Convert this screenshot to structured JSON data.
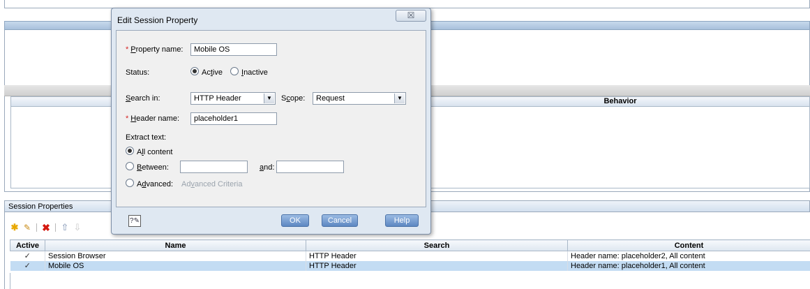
{
  "behavior_panel": {
    "column_header": "Behavior"
  },
  "session_properties": {
    "title": "Session Properties",
    "toolbar": {
      "add_icon": "add-star-icon",
      "edit_icon": "pencil-icon",
      "delete_icon": "red-x-icon",
      "move_up_icon": "arrow-up-icon",
      "move_down_icon": "arrow-down-icon"
    },
    "columns": [
      "Active",
      "Name",
      "Search",
      "Content"
    ],
    "rows": [
      {
        "active": "✓",
        "name": "Session Browser",
        "search": "HTTP Header",
        "content": "Header name: placeholder2, All content",
        "selected": false
      },
      {
        "active": "✓",
        "name": "Mobile OS",
        "search": "HTTP Header",
        "content": "Header name: placeholder1, All content",
        "selected": true
      }
    ]
  },
  "dialog": {
    "title": "Edit Session Property",
    "close_glyph": "☒",
    "property_name": {
      "label_prefix": "",
      "label_mnemonic": "P",
      "label_rest": "roperty name:",
      "value": "Mobile OS"
    },
    "status": {
      "label": "Status:",
      "active": {
        "pre": "Ac",
        "mnemonic": "t",
        "post": "ive",
        "selected": true
      },
      "inactive": {
        "pre": "",
        "mnemonic": "I",
        "post": "nactive",
        "selected": false
      }
    },
    "search_in": {
      "label_pre": "",
      "label_mnemonic": "S",
      "label_post": "earch in:",
      "value": "HTTP Header"
    },
    "scope": {
      "label_pre": "S",
      "label_mnemonic": "c",
      "label_post": "ope:",
      "value": "Request"
    },
    "header_name": {
      "label_pre": "",
      "label_mnemonic": "H",
      "label_post": "eader name:",
      "value": "placeholder1"
    },
    "extract_text": {
      "label": "Extract text:",
      "all_content": {
        "pre": "A",
        "mnemonic": "l",
        "post": "l content",
        "selected": true
      },
      "between": {
        "pre": "",
        "mnemonic": "B",
        "post": "etween:",
        "selected": false,
        "from_value": "",
        "to_value": ""
      },
      "and": {
        "pre": "",
        "mnemonic": "a",
        "post": "nd:"
      },
      "advanced": {
        "pre": "A",
        "mnemonic": "d",
        "post": "vanced:",
        "selected": false
      },
      "advanced_link": {
        "pre": "Ad",
        "mnemonic": "v",
        "post": "anced Criteria"
      }
    },
    "footer": {
      "help_icon": "help-document-icon",
      "ok": "OK",
      "cancel": "Cancel",
      "help": "Help"
    }
  }
}
